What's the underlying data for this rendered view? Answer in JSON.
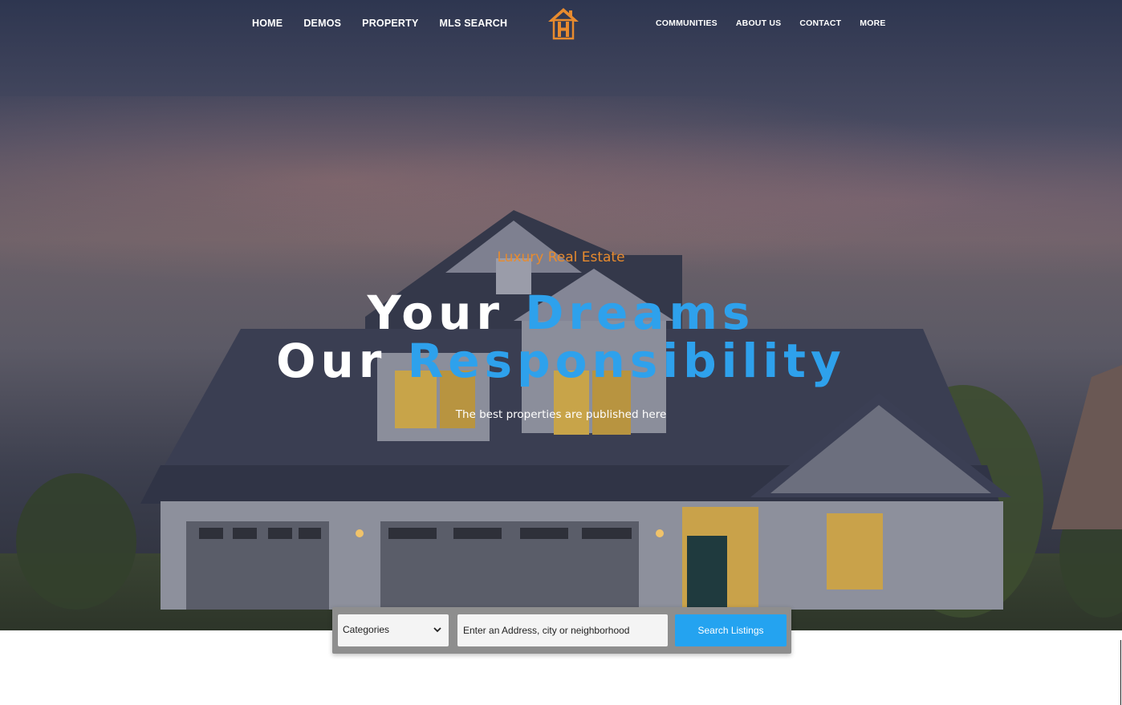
{
  "nav": {
    "left": [
      {
        "label": "HOME"
      },
      {
        "label": "DEMOS"
      },
      {
        "label": "PROPERTY"
      },
      {
        "label": "MLS SEARCH"
      }
    ],
    "right": [
      {
        "label": "COMMUNITIES"
      },
      {
        "label": "ABOUT US"
      },
      {
        "label": "CONTACT"
      },
      {
        "label": "MORE"
      }
    ],
    "logo_icon": "house-h-logo-icon",
    "logo_color": "#e88b2e"
  },
  "hero": {
    "tagline": "Luxury Real Estate",
    "line1_white": "Your",
    "line1_blue": "Dreams",
    "line2_white": "Our",
    "line2_blue": "Responsibility",
    "subtitle": "The best properties are published here",
    "accent_color": "#2ea1ec",
    "tagline_color": "#e88b2e"
  },
  "search": {
    "category_selected": "Categories",
    "address_placeholder": "Enter an Address, city or neighborhood",
    "button_label": "Search Listings",
    "dropdown_icon": "chevron-down-icon"
  }
}
